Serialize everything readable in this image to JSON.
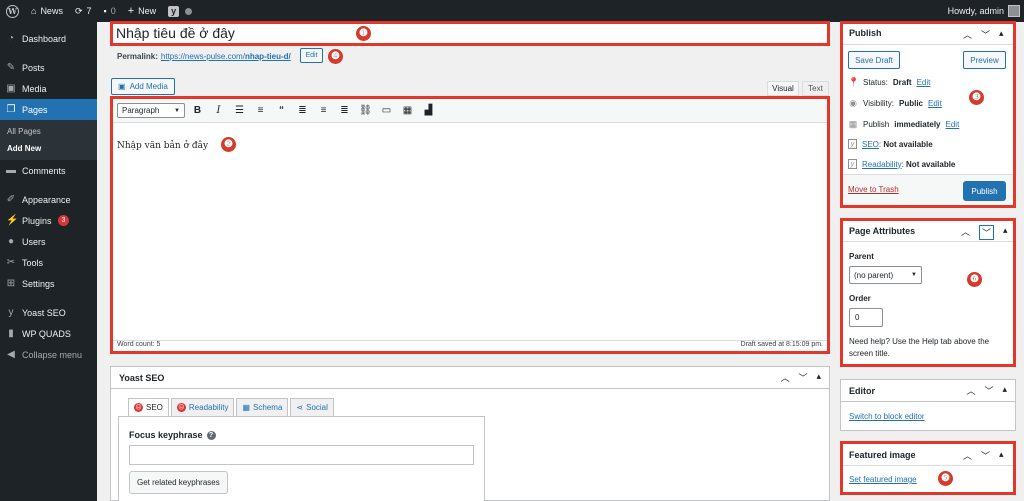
{
  "admin_bar": {
    "site_name": "News",
    "updates_count": "7",
    "comments_count": "0",
    "new_label": "New",
    "howdy": "Howdy, admin"
  },
  "sidebar": {
    "items": [
      {
        "label": "Dashboard",
        "icon": "dashboard-icon"
      },
      {
        "label": "Posts",
        "icon": "pin-icon"
      },
      {
        "label": "Media",
        "icon": "media-icon"
      },
      {
        "label": "Pages",
        "icon": "pages-icon"
      },
      {
        "label": "Comments",
        "icon": "comment-icon"
      },
      {
        "label": "Appearance",
        "icon": "brush-icon"
      },
      {
        "label": "Plugins",
        "icon": "plug-icon",
        "badge": "3"
      },
      {
        "label": "Users",
        "icon": "users-icon"
      },
      {
        "label": "Tools",
        "icon": "wrench-icon"
      },
      {
        "label": "Settings",
        "icon": "settings-icon"
      },
      {
        "label": "Yoast SEO",
        "icon": "yoast-icon"
      },
      {
        "label": "WP QUADS",
        "icon": "bars-icon"
      },
      {
        "label": "Collapse menu",
        "icon": "collapse-icon"
      }
    ],
    "submenu": [
      "All Pages",
      "Add New"
    ]
  },
  "editor": {
    "title": "Nhập tiêu đề ở đây",
    "permalink_label": "Permalink:",
    "permalink_base": "https://news-pulse.com/",
    "permalink_slug": "nhap-tieu-d/",
    "permalink_edit": "Edit",
    "add_media": "Add Media",
    "tab_visual": "Visual",
    "tab_text": "Text",
    "format_select": "Paragraph",
    "content": "Nhập văn bản ở đây",
    "word_count": "Word count: 5",
    "draft_saved": "Draft saved at 8:15:09 pm."
  },
  "markers": [
    "❶",
    "❷",
    "❸",
    "❹",
    "❺",
    "❻"
  ],
  "yoast": {
    "title": "Yoast SEO",
    "tabs": [
      "SEO",
      "Readability",
      "Schema",
      "Social"
    ],
    "focus_label": "Focus keyphrase",
    "focus_value": "",
    "related_button": "Get related keyphrases"
  },
  "publish": {
    "title": "Publish",
    "save_draft": "Save Draft",
    "preview": "Preview",
    "status_label": "Status:",
    "status_value": "Draft",
    "visibility_label": "Visibility:",
    "visibility_value": "Public",
    "publish_label": "Publish",
    "publish_value": "immediately",
    "edit": "Edit",
    "seo_label": "SEO",
    "seo_value": "Not available",
    "readability_label": "Readability",
    "readability_value": "Not available",
    "move_to_trash": "Move to Trash",
    "publish_button": "Publish"
  },
  "page_attributes": {
    "title": "Page Attributes",
    "parent_label": "Parent",
    "parent_value": "(no parent)",
    "order_label": "Order",
    "order_value": "0",
    "help_text": "Need help? Use the Help tab above the screen title."
  },
  "editor_box": {
    "title": "Editor",
    "switch_link": "Switch to block editor"
  },
  "featured_image": {
    "title": "Featured image",
    "set_link": "Set featured image"
  },
  "colors": {
    "highlight": "#e2372b",
    "accent": "#2271b1",
    "admin_dark": "#1d2327"
  }
}
